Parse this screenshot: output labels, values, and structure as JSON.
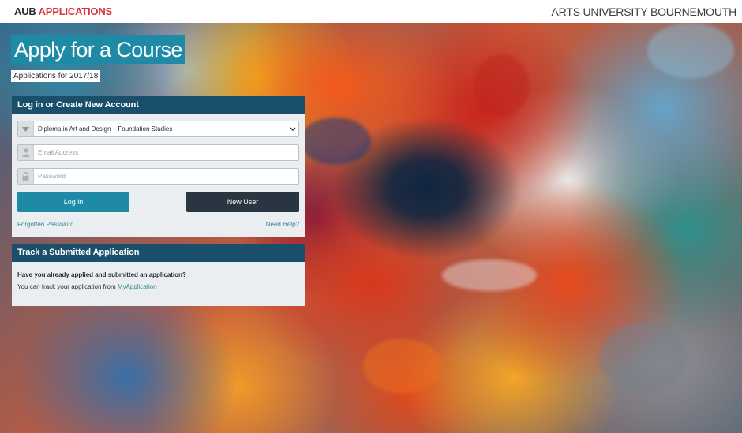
{
  "header": {
    "logo_aub": "AUB",
    "logo_applications": "APPLICATIONS",
    "university": "ARTS UNIVERSITY BOURNEMOUTH"
  },
  "hero": {
    "title": "Apply for a Course",
    "subtitle": "Applications for 2017/18"
  },
  "login": {
    "heading": "Log in or Create New Account",
    "course_select": {
      "value": "Diploma in Art and Design – Foundation Studies",
      "icon": "chevron-down-icon"
    },
    "email": {
      "placeholder": "Email Address",
      "icon": "user-icon"
    },
    "password": {
      "placeholder": "Password",
      "icon": "lock-icon"
    },
    "login_button": "Log in",
    "new_user_button": "New User",
    "forgot_link": "Forgotten Password",
    "help_link": "Need Help?"
  },
  "track": {
    "heading": "Track a Submitted Application",
    "question": "Have you already applied and submitted an application?",
    "answer_prefix": "You can track your application from ",
    "answer_link": "MyApplication"
  },
  "colors": {
    "brand_red": "#d6333b",
    "teal": "#1e8aa6",
    "panel_header": "#194f6b",
    "dark_button": "#2a3542",
    "link": "#2d8a90"
  }
}
